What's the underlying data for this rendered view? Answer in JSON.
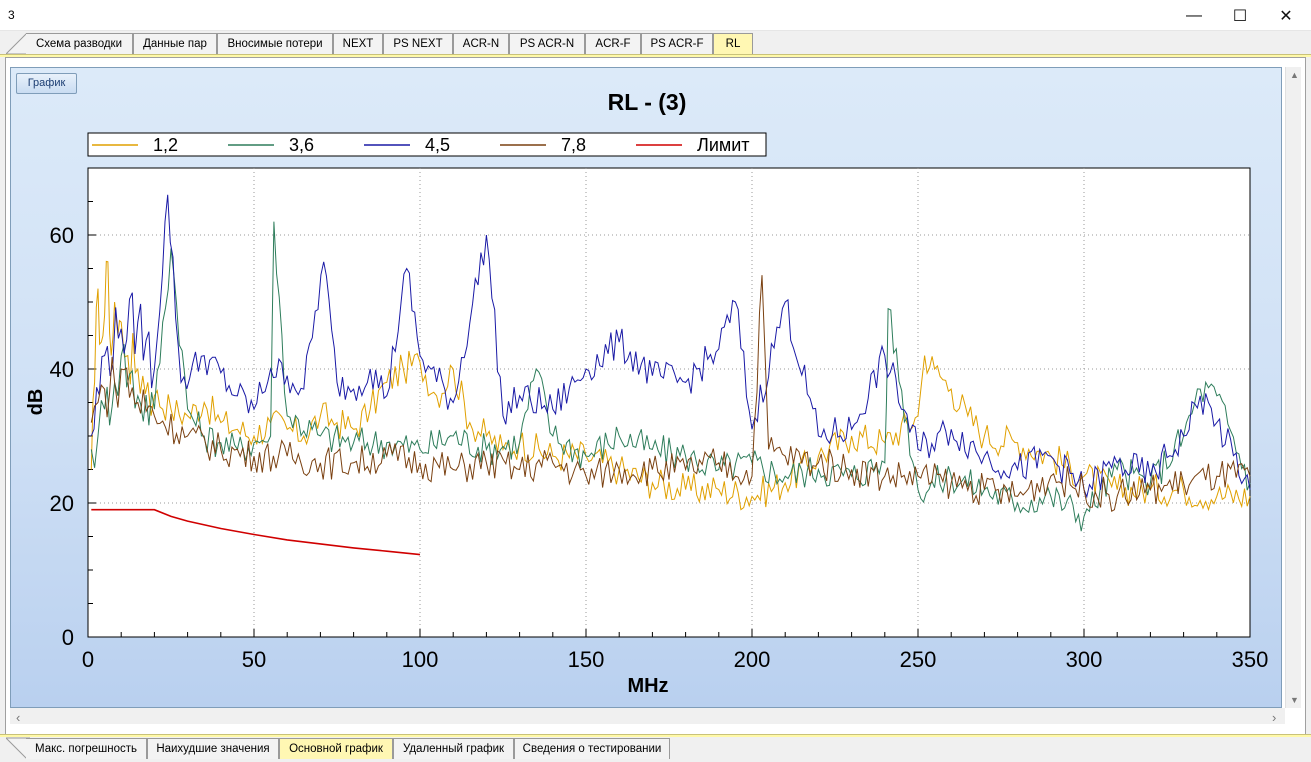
{
  "window": {
    "title": "3",
    "minimize_glyph": "—",
    "maximize_glyph": "☐",
    "close_glyph": "✕"
  },
  "top_tabs": [
    {
      "label": "Схема разводки",
      "active": false
    },
    {
      "label": "Данные пар",
      "active": false
    },
    {
      "label": "Вносимые потери",
      "active": false
    },
    {
      "label": "NEXT",
      "active": false
    },
    {
      "label": "PS NEXT",
      "active": false
    },
    {
      "label": "ACR-N",
      "active": false
    },
    {
      "label": "PS ACR-N",
      "active": false
    },
    {
      "label": "ACR-F",
      "active": false
    },
    {
      "label": "PS ACR-F",
      "active": false
    },
    {
      "label": "RL",
      "active": true
    }
  ],
  "bottom_tabs": [
    {
      "label": "Макс. погрешность",
      "active": false
    },
    {
      "label": "Наихудшие значения",
      "active": false
    },
    {
      "label": "Основной график",
      "active": true
    },
    {
      "label": "Удаленный график",
      "active": false
    },
    {
      "label": "Сведения о тестировании",
      "active": false
    }
  ],
  "graph_button": "График",
  "colors": {
    "tab_active": "#fff7b3",
    "series_12": "#e0a000",
    "series_36": "#2e7d5b",
    "series_45": "#1a1aa6",
    "series_78": "#7a4010",
    "limit": "#d00000"
  },
  "chart_data": {
    "type": "line",
    "title": "RL - (3)",
    "xlabel": "MHz",
    "ylabel": "dB",
    "xlim": [
      0,
      350
    ],
    "ylim": [
      0,
      70
    ],
    "x_ticks": [
      "0",
      "50",
      "100",
      "150",
      "200",
      "250",
      "300",
      "350"
    ],
    "y_ticks": [
      "0",
      "20",
      "40",
      "60"
    ],
    "grid": true,
    "legend_position": "top",
    "series": [
      {
        "name": "1,2",
        "color": "#e0a000",
        "x": [
          1,
          2,
          3,
          4,
          5,
          6,
          7,
          8,
          9,
          10,
          12,
          15,
          18,
          20,
          25,
          30,
          35,
          40,
          45,
          50,
          55,
          60,
          65,
          70,
          75,
          80,
          85,
          90,
          95,
          100,
          105,
          110,
          115,
          120,
          125,
          130,
          140,
          150,
          160,
          170,
          180,
          190,
          200,
          210,
          220,
          230,
          240,
          250,
          252,
          255,
          260,
          265,
          270,
          280,
          290,
          300,
          310,
          320,
          330,
          340,
          350
        ],
        "y": [
          25,
          38,
          52,
          44,
          48,
          56,
          42,
          50,
          45,
          47,
          42,
          40,
          38,
          36,
          34,
          33,
          35,
          32,
          31,
          30,
          32,
          31,
          30,
          33,
          32,
          31,
          34,
          38,
          40,
          41,
          36,
          40,
          32,
          30,
          28,
          29,
          27,
          27,
          25,
          23,
          22,
          22,
          21,
          23,
          27,
          30,
          29,
          33,
          42,
          40,
          37,
          33,
          30,
          29,
          27,
          24,
          22,
          22,
          22,
          21,
          21
        ]
      },
      {
        "name": "3,6",
        "color": "#2e7d5b",
        "x": [
          1,
          3,
          5,
          8,
          10,
          15,
          20,
          25,
          30,
          35,
          40,
          45,
          50,
          55,
          56,
          60,
          70,
          80,
          90,
          100,
          110,
          120,
          130,
          135,
          140,
          150,
          160,
          170,
          180,
          190,
          200,
          210,
          220,
          230,
          240,
          241,
          250,
          260,
          270,
          280,
          290,
          300,
          310,
          320,
          330,
          335,
          340,
          350
        ],
        "y": [
          28,
          30,
          34,
          38,
          42,
          36,
          34,
          58,
          34,
          30,
          29,
          28,
          29,
          30,
          62,
          33,
          30,
          29,
          29,
          28,
          30,
          28,
          29,
          40,
          30,
          27,
          30,
          28,
          27,
          25,
          26,
          24,
          25,
          24,
          26,
          49,
          22,
          24,
          22,
          20,
          21,
          18,
          25,
          23,
          30,
          37,
          36,
          23
        ]
      },
      {
        "name": "4,5",
        "color": "#1a1aa6",
        "x": [
          1,
          5,
          10,
          15,
          20,
          24,
          28,
          35,
          45,
          50,
          55,
          60,
          65,
          71,
          75,
          80,
          85,
          90,
          96,
          100,
          110,
          120,
          125,
          130,
          140,
          150,
          160,
          170,
          180,
          190,
          195,
          200,
          210,
          220,
          230,
          240,
          250,
          260,
          270,
          280,
          290,
          300,
          310,
          320,
          330,
          335,
          340,
          350
        ],
        "y": [
          30,
          42,
          46,
          47,
          40,
          66,
          38,
          42,
          36,
          34,
          40,
          39,
          37,
          56,
          38,
          37,
          40,
          36,
          55,
          42,
          35,
          60,
          33,
          36,
          34,
          40,
          44,
          39,
          38,
          43,
          50,
          31,
          50,
          30,
          31,
          42,
          28,
          31,
          27,
          25,
          27,
          22,
          26,
          24,
          30,
          36,
          32,
          22
        ]
      },
      {
        "name": "7,8",
        "color": "#7a4010",
        "x": [
          1,
          3,
          5,
          8,
          10,
          15,
          20,
          30,
          40,
          50,
          60,
          70,
          80,
          90,
          100,
          110,
          120,
          130,
          140,
          150,
          160,
          170,
          180,
          190,
          200,
          203,
          205,
          210,
          220,
          230,
          240,
          250,
          260,
          270,
          280,
          290,
          300,
          310,
          320,
          330,
          340,
          350
        ],
        "y": [
          32,
          35,
          37,
          38,
          40,
          35,
          33,
          30,
          28,
          27,
          27,
          26,
          26,
          27,
          26,
          25,
          26,
          25,
          26,
          24,
          25,
          25,
          25,
          26,
          24,
          54,
          28,
          27,
          26,
          25,
          24,
          24,
          23,
          22,
          21,
          24,
          22,
          21,
          22,
          23,
          24,
          24
        ]
      },
      {
        "name": "Лимит",
        "color": "#d00000",
        "x": [
          1,
          5,
          10,
          15,
          20,
          25,
          30,
          40,
          50,
          60,
          70,
          80,
          90,
          100
        ],
        "y": [
          19,
          19,
          19,
          19,
          19,
          18,
          17.3,
          16.2,
          15.3,
          14.5,
          13.9,
          13.3,
          12.8,
          12.3
        ]
      }
    ]
  }
}
